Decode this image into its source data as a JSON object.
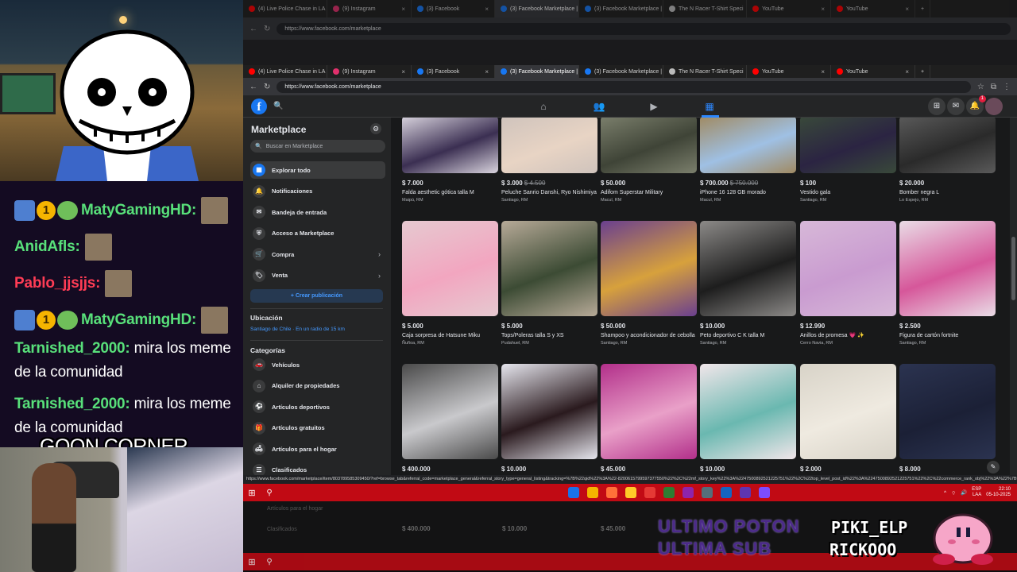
{
  "overlay": {
    "chat": [
      {
        "user": "MatyGamingHD:",
        "color": "#58e07a",
        "badges": true,
        "msg": ""
      },
      {
        "user": "AnidAfls:",
        "color": "#58e07a",
        "badges": false,
        "msg": ""
      },
      {
        "user": "Pablo_jjsjjs:",
        "color": "#ff3c55",
        "badges": false,
        "msg": ""
      },
      {
        "user": "MatyGamingHD:",
        "color": "#58e07a",
        "badges": true,
        "msg": ""
      },
      {
        "user": "Tarnished_2000:",
        "color": "#58e07a",
        "badges": false,
        "msg": "mira los meme"
      },
      {
        "user": "",
        "color": "#ffffff",
        "badges": false,
        "msg": "de la comunidad"
      },
      {
        "user": "Tarnished_2000:",
        "color": "#58e07a",
        "badges": false,
        "msg": "mira los meme"
      },
      {
        "user": "",
        "color": "#ffffff",
        "badges": false,
        "msg": "de la comunidad"
      }
    ],
    "caption": "GOON CORNER",
    "banner1": "ULTIMO POTON",
    "banner2": "ULTIMA SUB",
    "name1": "PIKI_ELP",
    "name2": "RICKOOO"
  },
  "ghost_browser": {
    "url": "https://www.facebook.com/marketplace"
  },
  "browser": {
    "tabs": [
      {
        "label": "(4) Live Police Chase in LA",
        "color": "#ff0000",
        "active": false
      },
      {
        "label": "(9) Instagram",
        "color": "#e1306c",
        "active": false
      },
      {
        "label": "(3) Facebook",
        "color": "#1877f2",
        "active": false
      },
      {
        "label": "(3) Facebook Marketplace |",
        "color": "#1877f2",
        "active": true
      },
      {
        "label": "(3) Facebook Marketplace |",
        "color": "#1877f2",
        "active": false
      },
      {
        "label": "The N Racer T-Shirt Speci",
        "color": "#bbbbbb",
        "active": false
      },
      {
        "label": "YouTube",
        "color": "#ff0000",
        "active": false
      },
      {
        "label": "YouTube",
        "color": "#ff0000",
        "active": false
      }
    ],
    "url": "https://www.facebook.com/marketplace",
    "status_url": "https://www.facebook.com/marketplace/item/803789585309450/?ref=browse_tab&referral_code=marketplace_general&referral_story_type=general_listing&tracking=%7B%22qid%22%3A%22-8200615799597377550%22%2C%22mf_story_key%22%3A%2247500892521225751%22%2C%22top_level_post_id%22%3A%2247500892521225751%22%2C%22commerce_rank_obj%22%3A%22%7B%5C%22target_"
  },
  "fb": {
    "notif_count": "1"
  },
  "sidebar": {
    "title": "Marketplace",
    "search_placeholder": "Buscar en Marketplace",
    "items": [
      {
        "label": "Explorar todo",
        "icon": "store-icon",
        "glyph": "▦"
      },
      {
        "label": "Notificaciones",
        "icon": "bell-icon",
        "glyph": "🔔"
      },
      {
        "label": "Bandeja de entrada",
        "icon": "inbox-icon",
        "glyph": "✉"
      },
      {
        "label": "Acceso a Marketplace",
        "icon": "shield-icon",
        "glyph": "⛨"
      },
      {
        "label": "Compra",
        "icon": "cart-icon",
        "glyph": "🛒"
      },
      {
        "label": "Venta",
        "icon": "tag-icon",
        "glyph": "🏷"
      }
    ],
    "create_label": "+ Crear publicación",
    "location_title": "Ubicación",
    "location_value": "Santiago de Chile · En un radio de 15 km",
    "categories_title": "Categorías",
    "categories": [
      {
        "label": "Vehículos",
        "icon": "car-icon",
        "glyph": "🚗"
      },
      {
        "label": "Alquiler de propiedades",
        "icon": "house-icon",
        "glyph": "⌂"
      },
      {
        "label": "Artículos deportivos",
        "icon": "sport-icon",
        "glyph": "⚽"
      },
      {
        "label": "Artículos gratuitos",
        "icon": "gift-icon",
        "glyph": "🎁"
      },
      {
        "label": "Artículos para el hogar",
        "icon": "sofa-icon",
        "glyph": "🛋"
      },
      {
        "label": "Clasificados",
        "icon": "list-icon",
        "glyph": "☰"
      }
    ]
  },
  "listings_row1": [
    {
      "price": "$ 7.000",
      "old": "",
      "title": "Falda aesthetic gótica talla M",
      "loc": "Maipú, RM",
      "bg": "#d9d4de",
      "fg": "#3b2f52"
    },
    {
      "price": "$ 3.000",
      "old": "$ 4.500",
      "title": "Peluche Sanrio Danshi, Ryo Nishimiya",
      "loc": "Santiago, RM",
      "bg": "#cfc3bc",
      "fg": "#e8d4c4"
    },
    {
      "price": "$ 50.000",
      "old": "",
      "title": "Adifom Superstar Military",
      "loc": "Macul, RM",
      "bg": "#7b7f6c",
      "fg": "#3f4437"
    },
    {
      "price": "$ 700.000",
      "old": "$ 750.000",
      "title": "iPhone 16 128 GB morado",
      "loc": "Macul, RM",
      "bg": "#a08a62",
      "fg": "#9fc0e4"
    },
    {
      "price": "$ 100",
      "old": "",
      "title": "Vestido gala",
      "loc": "Santiago, RM",
      "bg": "#39493a",
      "fg": "#2b2442"
    },
    {
      "price": "$ 20.000",
      "old": "",
      "title": "Bomber negra L",
      "loc": "Lo Espejo, RM",
      "bg": "#5a5a5a",
      "fg": "#2a2a2a"
    }
  ],
  "listings_row2": [
    {
      "price": "$ 5.000",
      "old": "",
      "title": "Caja sorpresa de Hatsune Miku",
      "loc": "Ñuñoa, RM",
      "bg": "#e6c9d0",
      "fg": "#f2a6c0"
    },
    {
      "price": "$ 5.000",
      "old": "",
      "title": "Tops/Poleras talla S y XS",
      "loc": "Pudahuel, RM",
      "bg": "#b7aa98",
      "fg": "#3c4b34"
    },
    {
      "price": "$ 50.000",
      "old": "",
      "title": "Shampoo y acondicionador de cebolla",
      "loc": "Santiago, RM",
      "bg": "#6a3f8f",
      "fg": "#d7a13c"
    },
    {
      "price": "$ 10.000",
      "old": "",
      "title": "Peto deportivo C K talla M",
      "loc": "Santiago, RM",
      "bg": "#8c8a88",
      "fg": "#1d1d1d"
    },
    {
      "price": "$ 12.990",
      "old": "",
      "title": "Anillos de promesa 💗 ✨",
      "loc": "Cerro Navia, RM",
      "bg": "#d7b8d8",
      "fg": "#c99bd0"
    },
    {
      "price": "$ 2.500",
      "old": "",
      "title": "Figura de cartón fortnite",
      "loc": "Santiago, RM",
      "bg": "#e9dce6",
      "fg": "#d6579a"
    }
  ],
  "listings_row3": [
    {
      "price": "$ 400.000",
      "bg": "#4a4a4a",
      "fg": "#c9c9cc"
    },
    {
      "price": "$ 10.000",
      "bg": "#e6e6ee",
      "fg": "#2a1a1e"
    },
    {
      "price": "$ 45.000",
      "bg": "#b22f8a",
      "fg": "#e9a0c8"
    },
    {
      "price": "$ 10.000",
      "bg": "#f1e6ea",
      "fg": "#6ab8b0"
    },
    {
      "price": "$ 2.000",
      "bg": "#d8d3c8",
      "fg": "#efeae0"
    },
    {
      "price": "$ 8.000",
      "bg": "#2b3350",
      "fg": "#1b2036"
    }
  ],
  "taskbar": {
    "lang": "ESP\nLAA",
    "time": "22:10",
    "date": "05-10-2025"
  },
  "ghost_lower": {
    "item1": "Artículos para el hogar",
    "item2": "Clasificados",
    "price1": "$ 400.000",
    "price2": "$ 10.000",
    "price3": "$ 45.000"
  }
}
